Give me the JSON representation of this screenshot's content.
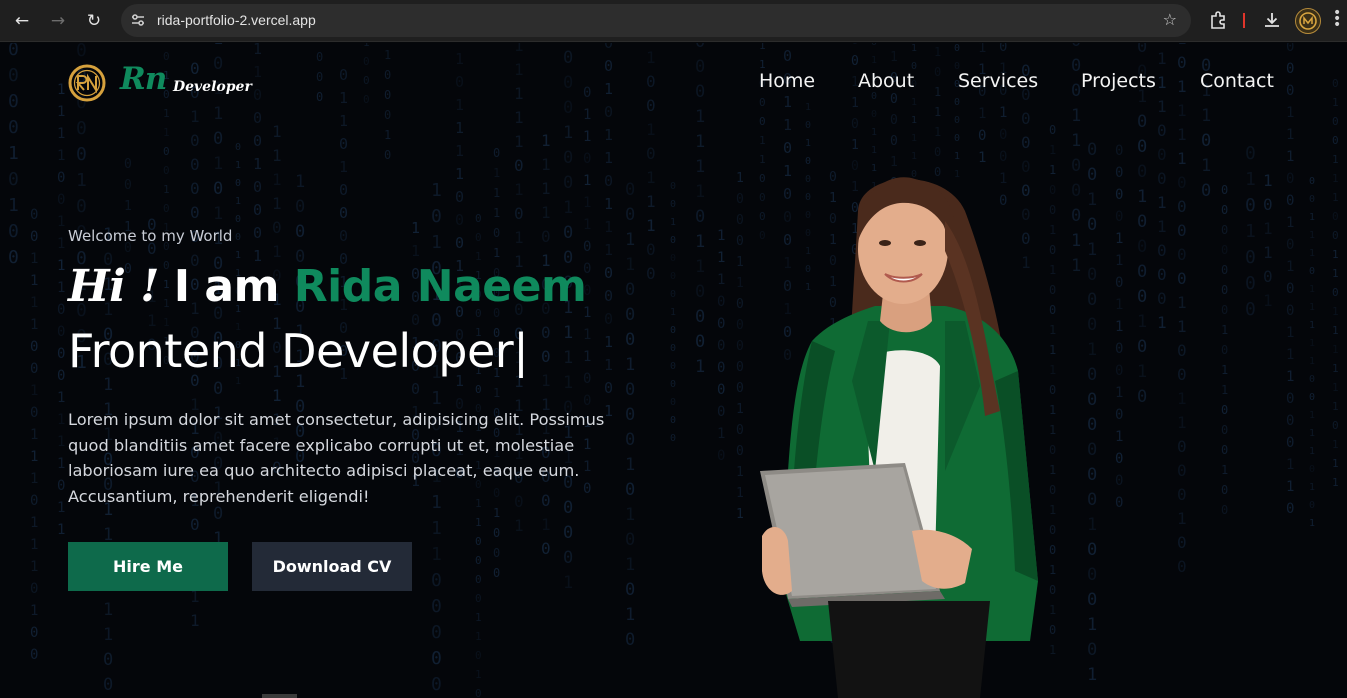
{
  "browser": {
    "url": "rida-portfolio-2.vercel.app"
  },
  "site": {
    "brand": "Rn",
    "brand_sub": "Developer",
    "nav": [
      {
        "label": "Home"
      },
      {
        "label": "About"
      },
      {
        "label": "Services"
      },
      {
        "label": "Projects"
      },
      {
        "label": "Contact"
      }
    ]
  },
  "hero": {
    "welcome": "Welcome to my World",
    "hi": "Hi !",
    "iam": " I am ",
    "name": "Rida Naeem",
    "role": "Frontend Developer|",
    "description": "Lorem ipsum dolor sit amet consectetur, adipisicing elit. Possimus quod blanditiis amet facere explicabo corrupti ut et, molestiae laboriosam iure ea quo architecto adipisci placeat, eaque eum. Accusantium, reprehenderit eligendi!",
    "hire_label": "Hire Me",
    "cv_label": "Download CV"
  },
  "colors": {
    "accent": "#0f8a5d",
    "hire_bg": "#0e6a4b",
    "cv_bg": "#232a37",
    "page_bg": "#04060a"
  },
  "icons": [
    "back-arrow-icon",
    "forward-arrow-icon",
    "reload-icon",
    "site-settings-icon",
    "star-icon",
    "extensions-icon",
    "download-icon",
    "profile-icon",
    "menu-kebab-icon",
    "logo-icon"
  ]
}
